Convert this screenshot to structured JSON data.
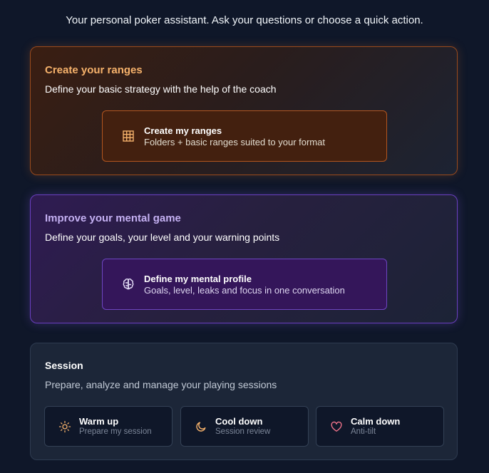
{
  "intro": "Your personal poker assistant. Ask your questions or choose a quick action.",
  "ranges_card": {
    "title": "Create your ranges",
    "subtitle": "Define your basic strategy with the help of the coach",
    "action": {
      "title": "Create my ranges",
      "description": "Folders + basic ranges suited to your format",
      "icon": "grid-icon"
    },
    "accent_color": "#f6b26b"
  },
  "mental_card": {
    "title": "Improve your mental game",
    "subtitle": "Define your goals, your level and your warning points",
    "action": {
      "title": "Define my mental profile",
      "description": "Goals, level, leaks and focus in one conversation",
      "icon": "brain-icon"
    },
    "accent_color": "#c4b0f2"
  },
  "session_card": {
    "title": "Session",
    "subtitle": "Prepare, analyze and manage your playing sessions",
    "actions": [
      {
        "title": "Warm up",
        "description": "Prepare my session",
        "icon": "sun-icon",
        "icon_color": "#f6b26b"
      },
      {
        "title": "Cool down",
        "description": "Session review",
        "icon": "moon-icon",
        "icon_color": "#f6b26b"
      },
      {
        "title": "Calm down",
        "description": "Anti-tilt",
        "icon": "heart-icon",
        "icon_color": "#f0738a"
      }
    ]
  }
}
